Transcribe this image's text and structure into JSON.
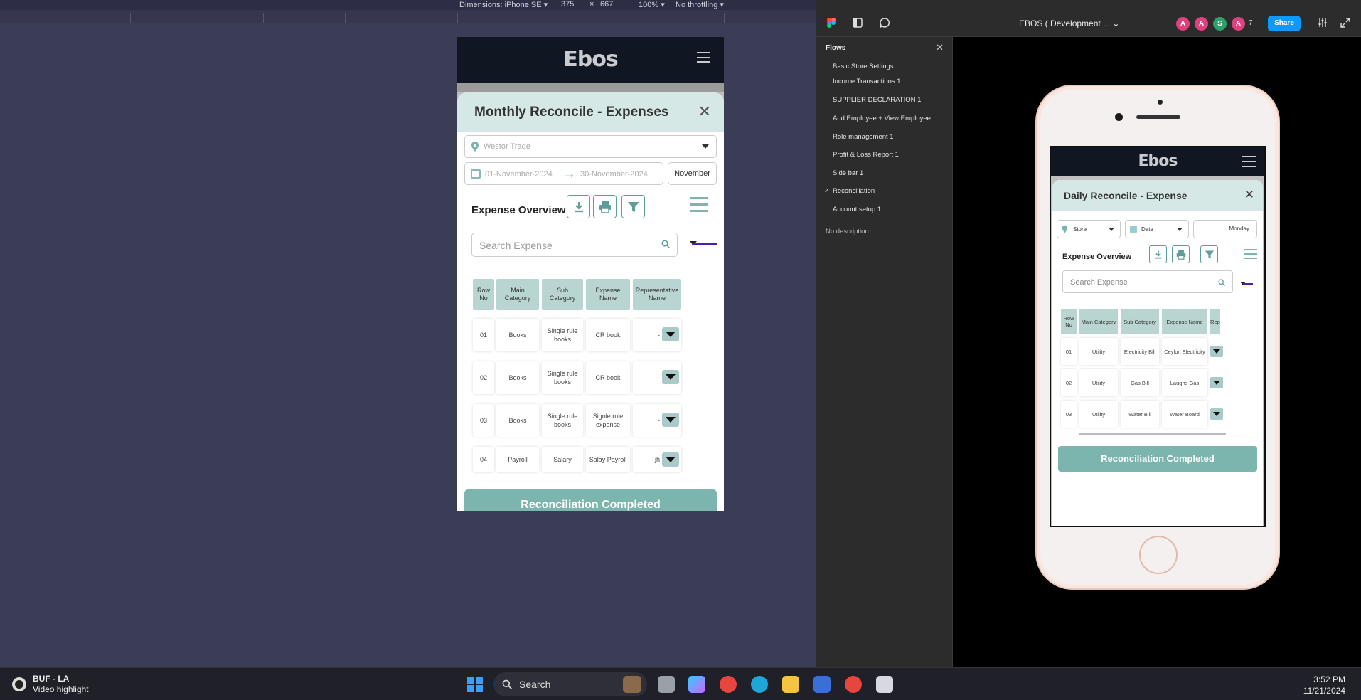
{
  "devtools": {
    "dimensions_label": "Dimensions: iPhone SE ▾",
    "width": "375",
    "times": "×",
    "height": "667",
    "zoom": "100% ▾",
    "throttling": "No throttling ▾"
  },
  "preview": {
    "logo": "Ebos",
    "modal_title": "Monthly Reconcile - Expenses",
    "close": "✕",
    "store_placeholder": "Westor Trade",
    "date_from": "01-November-2024",
    "date_arrow": "→",
    "date_to": "30-November-2024",
    "month": "November",
    "overview_title": "Expense Overview",
    "search_placeholder": "Search Expense",
    "columns": [
      "Row No",
      "Main Category",
      "Sub Category",
      "Expense Name",
      "Representative Name"
    ],
    "rows": [
      [
        "01",
        "Books",
        "Single rule books",
        "CR book",
        "-"
      ],
      [
        "02",
        "Books",
        "Single rule books",
        "CR book",
        "-"
      ],
      [
        "03",
        "Books",
        "Single rule books",
        "Signle rule expense",
        "-"
      ],
      [
        "04",
        "Payroll",
        "Salary",
        "Salay Payroll",
        "jh"
      ]
    ],
    "reconcile_button": "Reconciliation Completed"
  },
  "figma": {
    "file_title": "EBOS ( Development ...",
    "avatars": [
      "A",
      "A",
      "S",
      "A"
    ],
    "avatar_count": "7",
    "share": "Share",
    "flows_header": "Flows",
    "flows_close": "✕",
    "flows": [
      "Basic Store Settings",
      "Income Transactions 1",
      "SUPPLIER DECLARATION 1",
      "Add Employee + View Employee",
      "Role management 1",
      "Profit & Loss Report 1",
      "Side bar 1",
      "Reconciliation",
      "Account setup 1"
    ],
    "active_flow_check": "✓",
    "no_description": "No description"
  },
  "phone": {
    "logo": "Ebos",
    "modal_title": "Daily Reconcile - Expense",
    "close": "✕",
    "store": "Store",
    "date": "Date",
    "day": "Monday",
    "overview_title": "Expense Overview",
    "search_placeholder": "Search Expense",
    "columns": [
      "Row No",
      "Main Category",
      "Sub Category",
      "Expense Name",
      "Rep"
    ],
    "rows": [
      [
        "01",
        "Utility",
        "Electricity Bill",
        "Ceylon Electricity"
      ],
      [
        "02",
        "Utility",
        "Gas Bill",
        "Laughs Gas"
      ],
      [
        "03",
        "Utility",
        "Water Bill",
        "Water Board"
      ]
    ],
    "reconcile_button": "Reconciliation Completed"
  },
  "taskbar": {
    "news_title": "BUF - LA",
    "news_sub": "Video highlight",
    "search": "Search",
    "time": "3:52 PM",
    "date": "11/21/2024"
  },
  "colors": {
    "teal": "#7bb5ae",
    "teal_header": "#b8d5d2",
    "modal_head": "#d6e8e6",
    "figma_share": "#0d99ff"
  }
}
